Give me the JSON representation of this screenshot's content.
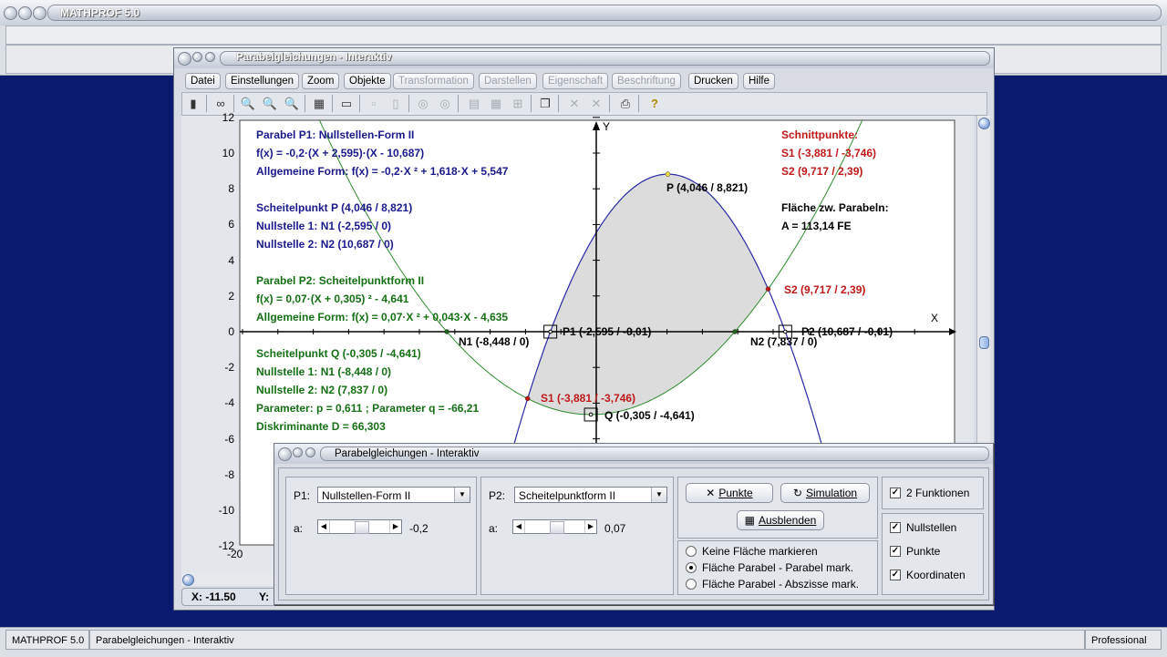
{
  "app": {
    "title": "MATHPROF 5.0"
  },
  "child_window": {
    "title": "Parabelgleichungen - Interaktiv"
  },
  "menu": [
    {
      "label": "Datei",
      "enabled": true
    },
    {
      "label": "Einstellungen",
      "enabled": true
    },
    {
      "label": "Zoom",
      "enabled": true
    },
    {
      "label": "Objekte",
      "enabled": true
    },
    {
      "label": "Transformation",
      "enabled": false
    },
    {
      "label": "Darstellen",
      "enabled": false
    },
    {
      "label": "Eigenschaft",
      "enabled": false
    },
    {
      "label": "Beschriftung",
      "enabled": false
    },
    {
      "label": "Drucken",
      "enabled": true
    },
    {
      "label": "Hilfe",
      "enabled": true
    }
  ],
  "plot": {
    "y_ticks": [
      "12",
      "10",
      "8",
      "6",
      "4",
      "2",
      "0",
      "-2",
      "-4",
      "-6",
      "-8",
      "-10",
      "-12"
    ],
    "x_tick_left": "-20",
    "x_axis_label": "X",
    "y_axis_label": "Y",
    "p1_info": {
      "title": "Parabel P1: Nullstellen-Form II",
      "eq": "f(x) = -0,2·(X + 2,595)·(X - 10,687)",
      "general": "Allgemeine Form: f(x) = -0,2·X ² + 1,618·X + 5,547",
      "vertex": "Scheitelpunkt P (4,046 / 8,821)",
      "root1": "Nullstelle 1: N1 (-2,595 / 0)",
      "root2": "Nullstelle 2: N2 (10,687 / 0)"
    },
    "p2_info": {
      "title": "Parabel P2: Scheitelpunktform II",
      "eq": "f(x) = 0,07·(X + 0,305) ² - 4,641",
      "general": "Allgemeine Form: f(x) = 0,07·X ² + 0,043·X - 4,635",
      "vertex": "Scheitelpunkt Q (-0,305 / -4,641)",
      "root1": "Nullstelle 1: N1 (-8,448 / 0)",
      "root2": "Nullstelle 2: N2 (7,837 / 0)",
      "params": "Parameter: p = 0,611 ; Parameter q = -66,21",
      "disc": "Diskriminante D = 66,303"
    },
    "intersections": {
      "title": "Schnittpunkte:",
      "s1": "S1 (-3,881 / -3,746)",
      "s2": "S2 (9,717 / 2,39)",
      "area_label": "Fläche zw. Parabeln:",
      "area_value": "A = 113,14 FE"
    },
    "labels": {
      "P": "P (4,046 / 8,821)",
      "S2": "S2 (9,717 / 2,39)",
      "N1": "N1 (-8,448 / 0)",
      "P1": "P1 (-2,595 / -0,01)",
      "N2": "N2 (7,837 / 0)",
      "P2": "P2 (10,687 / -0,01)",
      "S1": "S1 (-3,881 / -3,746)",
      "Q": "Q (-0,305 / -4,641)"
    },
    "colors": {
      "p1": "#2a2aa8",
      "p2": "#2e8b2e",
      "area": "#dcdcdc",
      "intersection": "#c01818"
    }
  },
  "coords": {
    "x": "X: -11.50",
    "y": "Y:"
  },
  "dialog": {
    "title": "Parabelgleichungen - Interaktiv",
    "p1_label": "P1:",
    "p1_select": "Nullstellen-Form II",
    "p2_label": "P2:",
    "p2_select": "Scheitelpunktform II",
    "a_label": "a:",
    "a1_value": "-0,2",
    "a2_value": "0,07",
    "btn_points": "Punkte",
    "btn_simulation": "Simulation",
    "btn_hide": "Ausblenden",
    "radios": [
      {
        "label": "Keine Fläche markieren",
        "checked": false
      },
      {
        "label": "Fläche Parabel - Parabel mark.",
        "checked": true
      },
      {
        "label": "Fläche Parabel - Abszisse mark.",
        "checked": false
      }
    ],
    "chk_two": {
      "label": "2 Funktionen",
      "checked": true
    },
    "chk_roots": {
      "label": "Nullstellen",
      "checked": true
    },
    "chk_points": {
      "label": "Punkte",
      "checked": true
    },
    "chk_coords": {
      "label": "Koordinaten",
      "checked": true
    }
  },
  "status": {
    "app": "MATHPROF 5.0",
    "doc": "Parabelgleichungen - Interaktiv",
    "edition": "Professional"
  }
}
